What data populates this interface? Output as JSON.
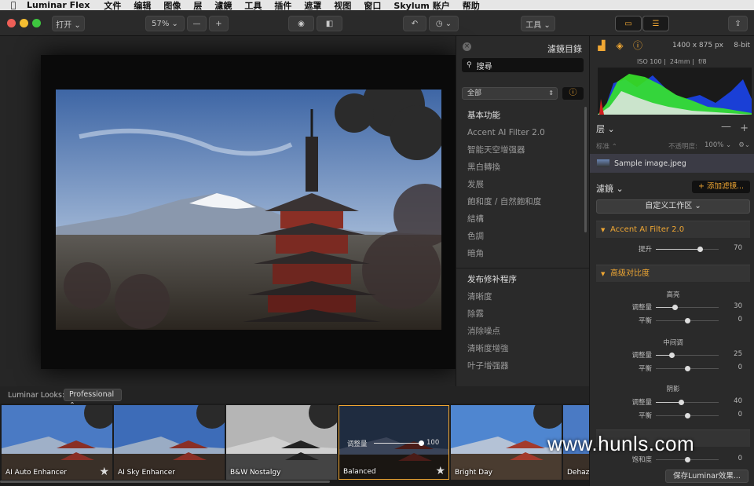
{
  "menubar": {
    "apple_icon": "apple-icon",
    "app": "Luminar Flex",
    "items": [
      "文件",
      "编辑",
      "图像",
      "层",
      "濾鏡",
      "工具",
      "插件",
      "遮罩",
      "视图",
      "窗口",
      "Skylum 账户",
      "帮助"
    ]
  },
  "toolbar": {
    "open_label": "打开 ⌄",
    "zoom_value": "57%",
    "zoom_out": "—",
    "zoom_in": "+",
    "eye_icon": "◉",
    "compare_icon": "◧",
    "undo_icon": "↶",
    "history_icon": "◷ ⌄",
    "tools_label": "工具 ⌄",
    "view_toggle_icon": "▭",
    "adjust_icon": "☰",
    "share_icon": "⇪"
  },
  "filters_panel": {
    "title": "濾鏡目錄",
    "search_placeholder": "搜尋",
    "category": "全部",
    "info_icon": "ⓘ",
    "group1": [
      "基本功能",
      "Accent AI Filter 2.0",
      "智能天空增强器",
      "黑白轉換",
      "发展",
      "飽和度 / 自然飽和度",
      "結構",
      "色調",
      "暗角"
    ],
    "group2": [
      "发布修补程序",
      "清晰度",
      "除霧",
      "消除噪点",
      "清晰度增強",
      "叶子增强器"
    ]
  },
  "right_panel": {
    "dimensions": "1400 x 875 px",
    "bits": "8-bit",
    "exif": [
      "ISO 100",
      "24mm",
      "f/8"
    ],
    "layers_label": "层 ⌄",
    "blend_mode": "标准 ⌃",
    "opacity_label": "不透明度:",
    "opacity_value": "100% ⌄",
    "layer_name": "Sample image.jpeg",
    "filters_label": "濾鏡 ⌄",
    "add_filter": "+ 添加滤镜...",
    "workspace": "自定义工作区 ⌄",
    "accent_title": "Accent AI Filter 2.0",
    "accent_slider": {
      "label": "提升",
      "value": "70",
      "level": 0.7
    },
    "contrast_title": "高级对比度",
    "contrast": [
      {
        "section": "高亮",
        "amount_label": "调整量",
        "amount": "30",
        "amount_level": 0.3,
        "balance_label": "平衡",
        "balance": "0",
        "balance_level": 0.5
      },
      {
        "section": "中间调",
        "amount_label": "调整量",
        "amount": "25",
        "amount_level": 0.25,
        "balance_label": "平衡",
        "balance": "0",
        "balance_level": 0.5
      },
      {
        "section": "阴影",
        "amount_label": "调整量",
        "amount": "40",
        "amount_level": 0.4,
        "balance_label": "平衡",
        "balance": "0",
        "balance_level": 0.5
      }
    ],
    "saturation_label": "饱和度",
    "saturation_value": "0",
    "save_button": "保存Luminar效果..."
  },
  "looks": {
    "label": "Luminar Looks:",
    "collection": "Professional ⌃",
    "items": [
      {
        "name": "AI Auto Enhancer",
        "star": "★"
      },
      {
        "name": "AI Sky Enhancer",
        "star": ""
      },
      {
        "name": "B&W Nostalgy",
        "star": ""
      },
      {
        "name": "Balanced",
        "star": "★",
        "adj_label": "调整量",
        "adj_value": "100"
      },
      {
        "name": "Bright Day",
        "star": ""
      },
      {
        "name": "Dehaze",
        "star": ""
      }
    ]
  },
  "watermark": "www.hunls.com",
  "colors": {
    "accent": "#f0a733",
    "panel": "#2a2a2a",
    "toolbar": "#2b2b2b"
  }
}
